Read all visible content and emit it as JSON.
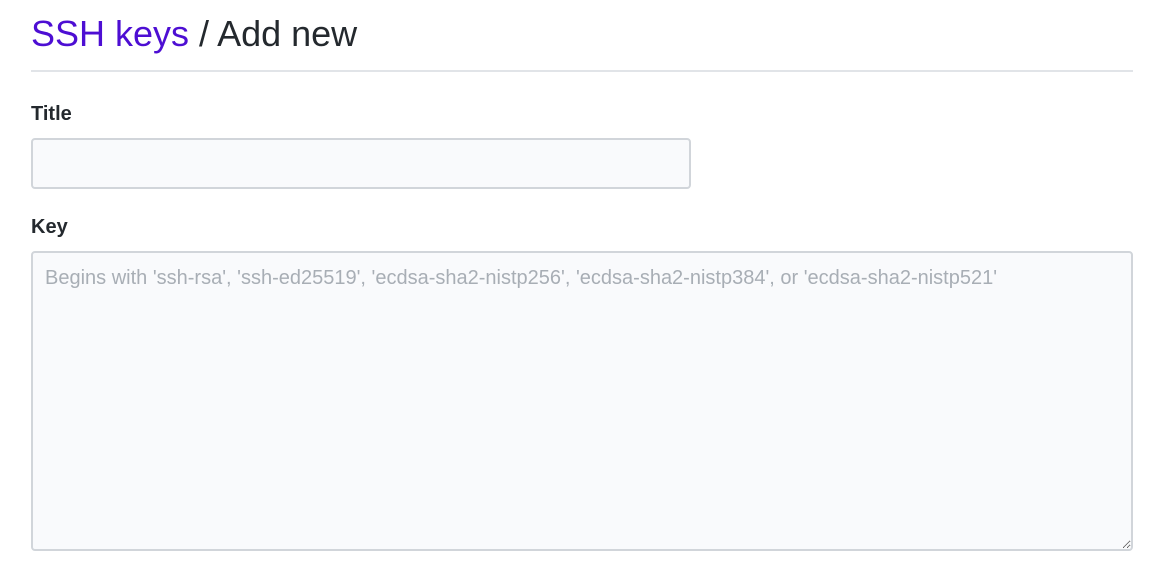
{
  "breadcrumb": {
    "parent_label": "SSH keys",
    "separator": " / ",
    "current_label": "Add new"
  },
  "form": {
    "title_label": "Title",
    "title_value": "",
    "key_label": "Key",
    "key_value": "",
    "key_placeholder": "Begins with 'ssh-rsa', 'ssh-ed25519', 'ecdsa-sha2-nistp256', 'ecdsa-sha2-nistp384', or 'ecdsa-sha2-nistp521'"
  },
  "colors": {
    "link": "#4d0ed3",
    "text": "#24292e",
    "border": "#d1d5da",
    "input_bg": "#f9fafc",
    "placeholder": "#a8aeb5"
  }
}
